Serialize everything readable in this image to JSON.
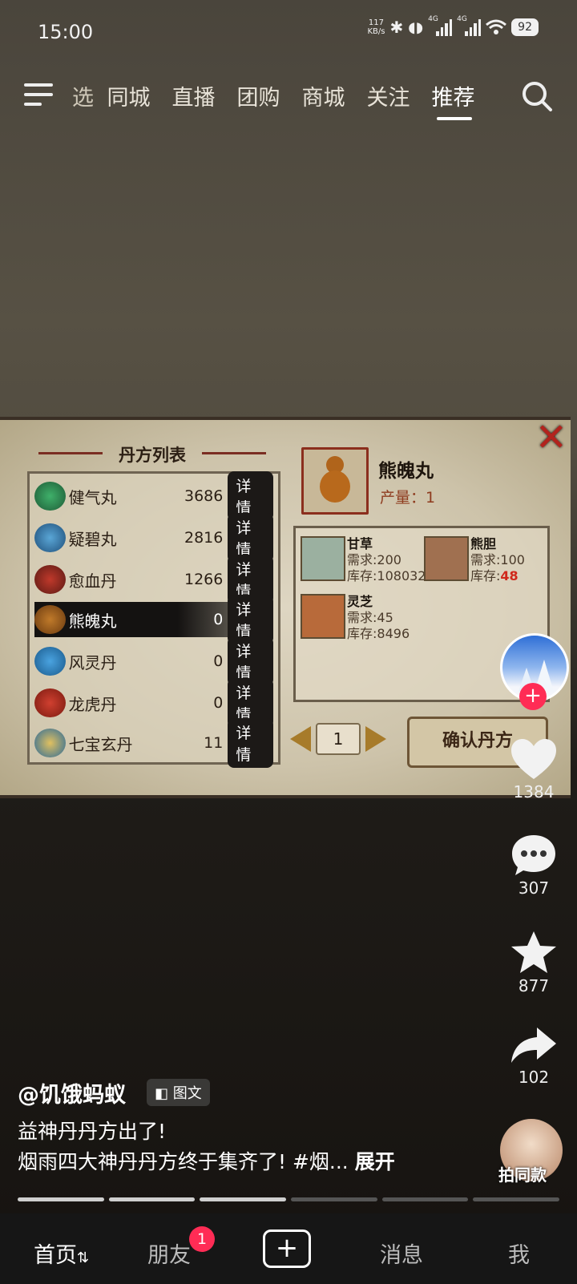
{
  "status": {
    "time": "15:00",
    "speed_value": "117",
    "speed_unit": "KB/s",
    "net1": "4G",
    "net2": "4G",
    "battery": "92"
  },
  "topnav": {
    "tabs": [
      "选",
      "同城",
      "直播",
      "团购",
      "商城",
      "关注",
      "推荐"
    ],
    "active": "推荐"
  },
  "game": {
    "list_title": "丹方列表",
    "rows": [
      {
        "name": "健气丸",
        "count": "3686",
        "btn": "详情"
      },
      {
        "name": "疑碧丸",
        "count": "2816",
        "btn": "详情"
      },
      {
        "name": "愈血丹",
        "count": "1266",
        "btn": "详情"
      },
      {
        "name": "熊魄丸",
        "count": "0",
        "btn": "详情"
      },
      {
        "name": "风灵丹",
        "count": "0",
        "btn": "详情"
      },
      {
        "name": "龙虎丹",
        "count": "0",
        "btn": "详情"
      },
      {
        "name": "七宝玄丹",
        "count": "11",
        "btn": "详情"
      }
    ],
    "product": {
      "name": "熊魄丸",
      "yield": "产量：1"
    },
    "ingredients": [
      {
        "name": "甘草",
        "need": "需求:200",
        "stock_label": "库存:",
        "stock": "108032"
      },
      {
        "name": "熊胆",
        "need": "需求:100",
        "stock_label": "库存:",
        "stock": "48"
      },
      {
        "name": "灵芝",
        "need": "需求:45",
        "stock_label": "库存:",
        "stock": "8496"
      }
    ],
    "page": "1",
    "confirm": "确认丹方"
  },
  "rail": {
    "likes": "1384",
    "comments": "307",
    "favorites": "877",
    "shares": "102",
    "same_style": "拍同款"
  },
  "post": {
    "author": "@饥饿蚂蚁",
    "type_tag": "图文",
    "line1": "益神丹丹方出了!",
    "line2": "烟雨四大神丹丹方终于集齐了! #烟... ",
    "expand": "展开"
  },
  "bottom_nav": {
    "home": "首页",
    "friends": "朋友",
    "friends_badge": "1",
    "messages": "消息",
    "me": "我"
  }
}
